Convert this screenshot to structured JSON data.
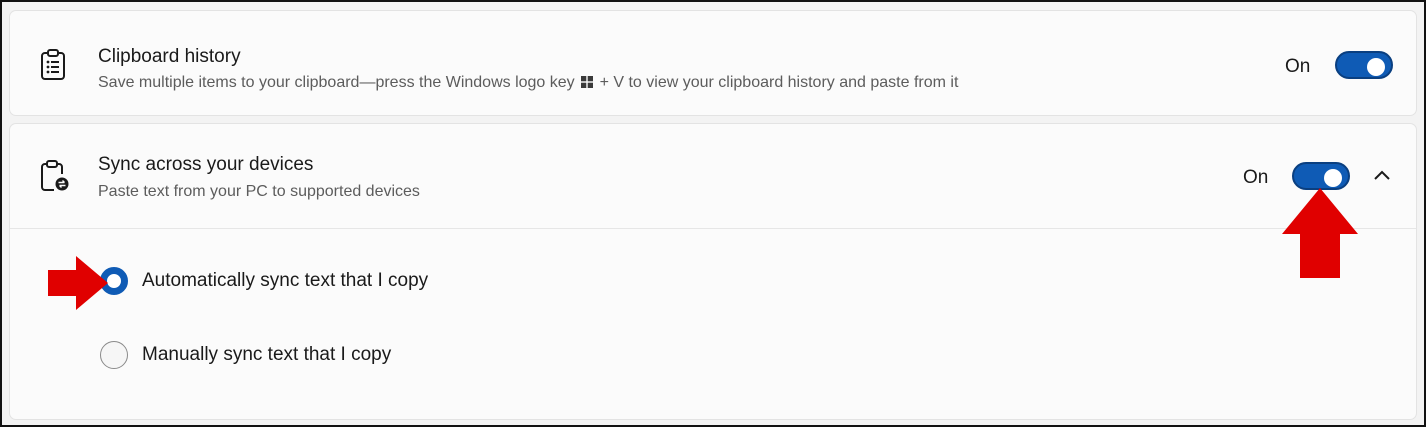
{
  "colors": {
    "accent": "#0f5bb5",
    "annotation_arrow": "#e00000",
    "text": "#1a1a1a",
    "subtext": "#5c5c5c"
  },
  "clipboard_history": {
    "icon": "clipboard-list-icon",
    "title": "Clipboard history",
    "description_before": "Save multiple items to your clipboard—press the Windows logo key",
    "description_after": "+ V to view your clipboard history and paste from it",
    "description_icon": "windows-logo-icon",
    "state_label": "On",
    "toggle_on": true
  },
  "sync_devices": {
    "icon": "clipboard-sync-icon",
    "title": "Sync across your devices",
    "description": "Paste text from your PC to supported devices",
    "state_label": "On",
    "toggle_on": true,
    "expanded": true,
    "expand_icon": "chevron-up-icon",
    "options": [
      {
        "label": "Automatically sync text that I copy",
        "selected": true
      },
      {
        "label": "Manually sync text that I copy",
        "selected": false
      }
    ]
  },
  "annotations": [
    {
      "type": "arrow",
      "direction": "up",
      "target": "sync-toggle"
    },
    {
      "type": "arrow",
      "direction": "right",
      "target": "auto-sync-radio"
    }
  ]
}
